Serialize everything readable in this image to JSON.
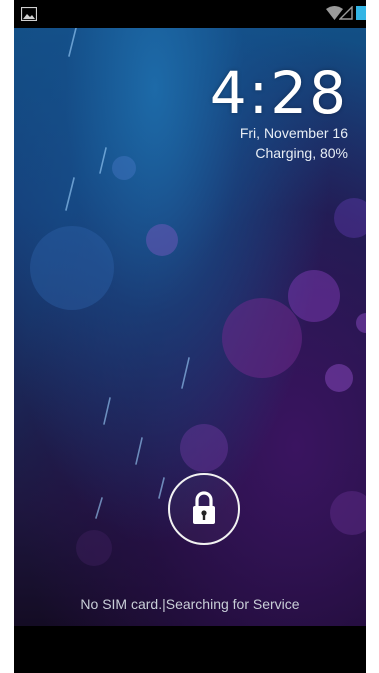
{
  "status_bar": {
    "notification_icon": "image-notification-icon",
    "wifi_icon": "wifi-icon",
    "signal_icon": "signal-icon",
    "battery_icon": "battery-icon",
    "accent_color": "#33b5e5"
  },
  "lock_screen": {
    "time": "4:28",
    "date": "Fri, November 16",
    "charging_status": "Charging, 80%",
    "unlock_icon": "lock-icon",
    "carrier_text": "No SIM card.|Searching for Service"
  }
}
